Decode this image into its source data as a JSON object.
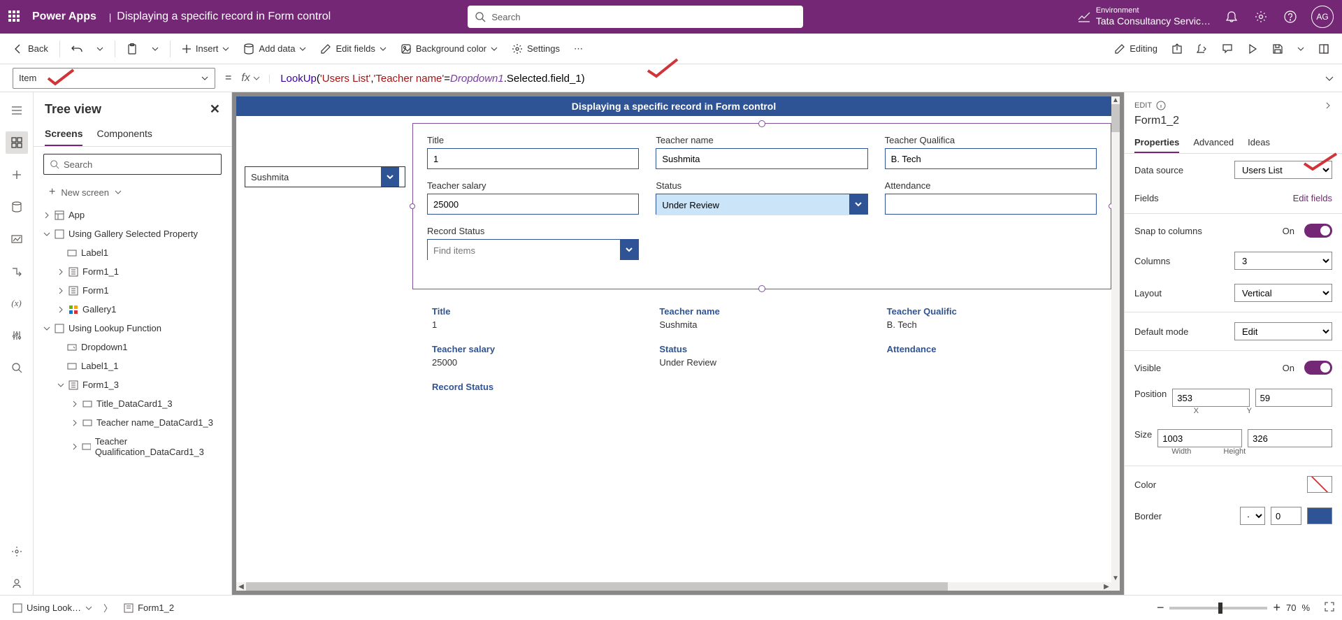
{
  "header": {
    "app": "Power Apps",
    "doc": "Displaying a specific record in Form control",
    "search_placeholder": "Search",
    "env_label": "Environment",
    "env_name": "Tata Consultancy Servic…",
    "avatar": "AG"
  },
  "cmdbar": {
    "back": "Back",
    "insert": "Insert",
    "add_data": "Add data",
    "edit_fields": "Edit fields",
    "bg_color": "Background color",
    "settings": "Settings",
    "editing": "Editing"
  },
  "fx": {
    "property": "Item",
    "formula_fn": "LookUp",
    "formula_str1": "'Users List'",
    "formula_str2": "'Teacher name'",
    "formula_id": "Dropdown1",
    "formula_tail": ".Selected.field_1)"
  },
  "tree": {
    "title": "Tree view",
    "tab_screens": "Screens",
    "tab_components": "Components",
    "search_placeholder": "Search",
    "new_screen": "New screen",
    "nodes": {
      "app": "App",
      "screen1": "Using Gallery Selected Property",
      "label1": "Label1",
      "form1_1": "Form1_1",
      "form1": "Form1",
      "gallery1": "Gallery1",
      "screen2": "Using Lookup Function",
      "dropdown1": "Dropdown1",
      "label1_1": "Label1_1",
      "form1_3": "Form1_3",
      "dc1": "Title_DataCard1_3",
      "dc2": "Teacher name_DataCard1_3",
      "dc3": "Teacher Qualification_DataCard1_3"
    }
  },
  "canvas": {
    "screen_title": "Displaying a specific record in Form control",
    "dropdown_value": "Sushmita",
    "form": {
      "title_label": "Title",
      "title_val": "1",
      "teacher_label": "Teacher name",
      "teacher_val": "Sushmita",
      "qual_label": "Teacher Qualifica",
      "qual_val": "B. Tech",
      "salary_label": "Teacher salary",
      "salary_val": "25000",
      "status_label": "Status",
      "status_val": "Under Review",
      "attendance_label": "Attendance",
      "attendance_val": "",
      "record_status_label": "Record Status",
      "record_status_ph": "Find items"
    },
    "form2": {
      "title_label": "Title",
      "title_val": "1",
      "teacher_label": "Teacher name",
      "teacher_val": "Sushmita",
      "qual_label": "Teacher Qualific",
      "qual_val": "B. Tech",
      "salary_label": "Teacher salary",
      "salary_val": "25000",
      "status_label": "Status",
      "status_val": "Under Review",
      "attendance_label": "Attendance",
      "attendance_val": "",
      "record_status_label": "Record Status"
    }
  },
  "props": {
    "edit": "EDIT",
    "control_name": "Form1_2",
    "tab_properties": "Properties",
    "tab_advanced": "Advanced",
    "tab_ideas": "Ideas",
    "data_source": "Data source",
    "data_source_val": "Users List",
    "fields": "Fields",
    "edit_fields": "Edit fields",
    "snap": "Snap to columns",
    "snap_val": "On",
    "columns": "Columns",
    "columns_val": "3",
    "layout": "Layout",
    "layout_val": "Vertical",
    "default_mode": "Default mode",
    "default_mode_val": "Edit",
    "visible": "Visible",
    "visible_val": "On",
    "position": "Position",
    "pos_x": "353",
    "pos_y": "59",
    "pos_x_label": "X",
    "pos_y_label": "Y",
    "size": "Size",
    "size_w": "1003",
    "size_h": "326",
    "size_w_label": "Width",
    "size_h_label": "Height",
    "color": "Color",
    "border": "Border",
    "border_val": "0"
  },
  "status": {
    "crumb1": "Using Look…",
    "crumb2": "Form1_2",
    "zoom": "70",
    "zoom_pct": "%"
  }
}
